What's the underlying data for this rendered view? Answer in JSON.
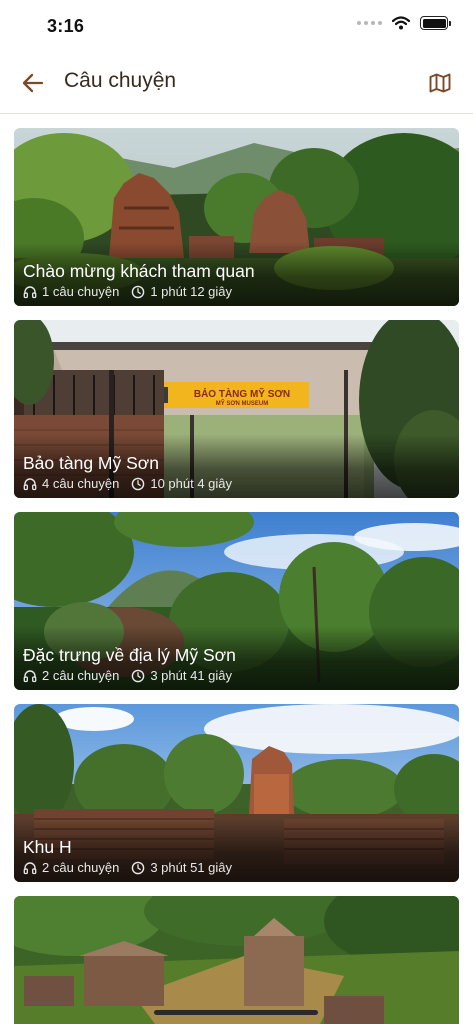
{
  "status_bar": {
    "time": "3:16"
  },
  "header": {
    "title": "Câu chuyện"
  },
  "colors": {
    "accent": "#7a4a28",
    "title_text": "#3a2a1e"
  },
  "icons": {
    "back": "arrow-left-icon",
    "map": "map-icon",
    "audio": "headphones-icon",
    "duration": "clock-icon"
  },
  "stories": [
    {
      "title": "Chào mừng khách tham quan",
      "count": "1 câu chuyện",
      "duration": "1 phút 12 giây"
    },
    {
      "title": "Bảo tàng Mỹ Sơn",
      "count": "4 câu chuyện",
      "duration": "10 phút 4 giây",
      "sign_main": "BẢO TÀNG MỸ SƠN",
      "sign_sub": "MỸ SƠN MUSEUM"
    },
    {
      "title": "Đặc trưng về địa lý Mỹ Sơn",
      "count": "2 câu chuyện",
      "duration": "3 phút 41 giây"
    },
    {
      "title": "Khu H",
      "count": "2 câu chuyện",
      "duration": "3 phút 51 giây"
    }
  ]
}
